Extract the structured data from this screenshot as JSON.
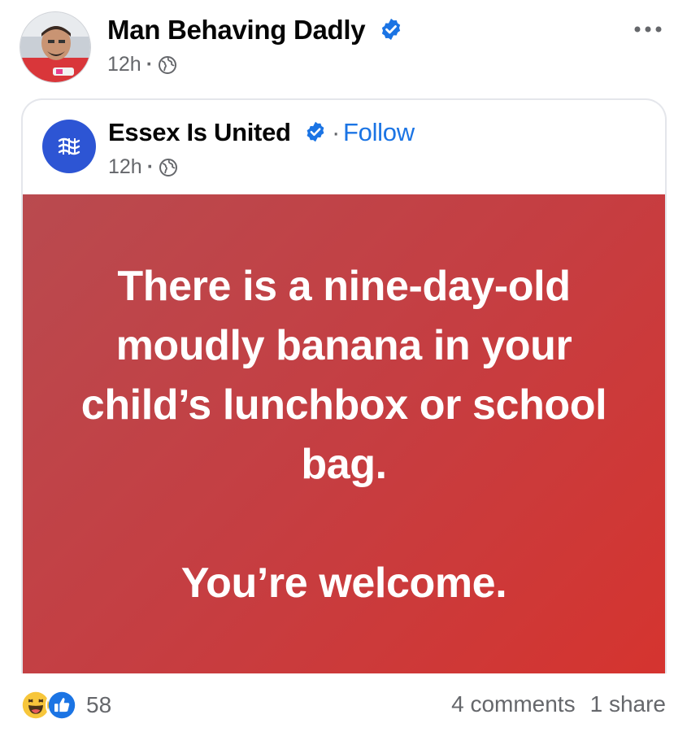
{
  "post": {
    "author": "Man Behaving Dadly",
    "time": "12h",
    "separator": "·",
    "more_label": "•••"
  },
  "shared": {
    "page_name": "Essex Is United",
    "separator": "·",
    "follow_label": "Follow",
    "time": "12h",
    "text_main": "There is a nine-day-old moudly banana in your child’s lunchbox or school bag.",
    "text_sub": "You’re welcome."
  },
  "footer": {
    "reaction_count": "58",
    "comments": "4 comments",
    "shares": "1 share"
  },
  "colors": {
    "verified": "#1b74e4",
    "follow": "#1b74e4",
    "post_background_start": "#b94a4f",
    "post_background_end": "#d5342f",
    "page_avatar": "#2d55d4",
    "meta_text": "#65676b"
  },
  "icons": {
    "verified": "verified-badge-icon",
    "globe": "globe-icon",
    "like": "like-thumb-icon",
    "haha": "haha-emoji-icon",
    "more": "more-dots-icon",
    "page_logo": "essex-shield-logo-icon"
  }
}
